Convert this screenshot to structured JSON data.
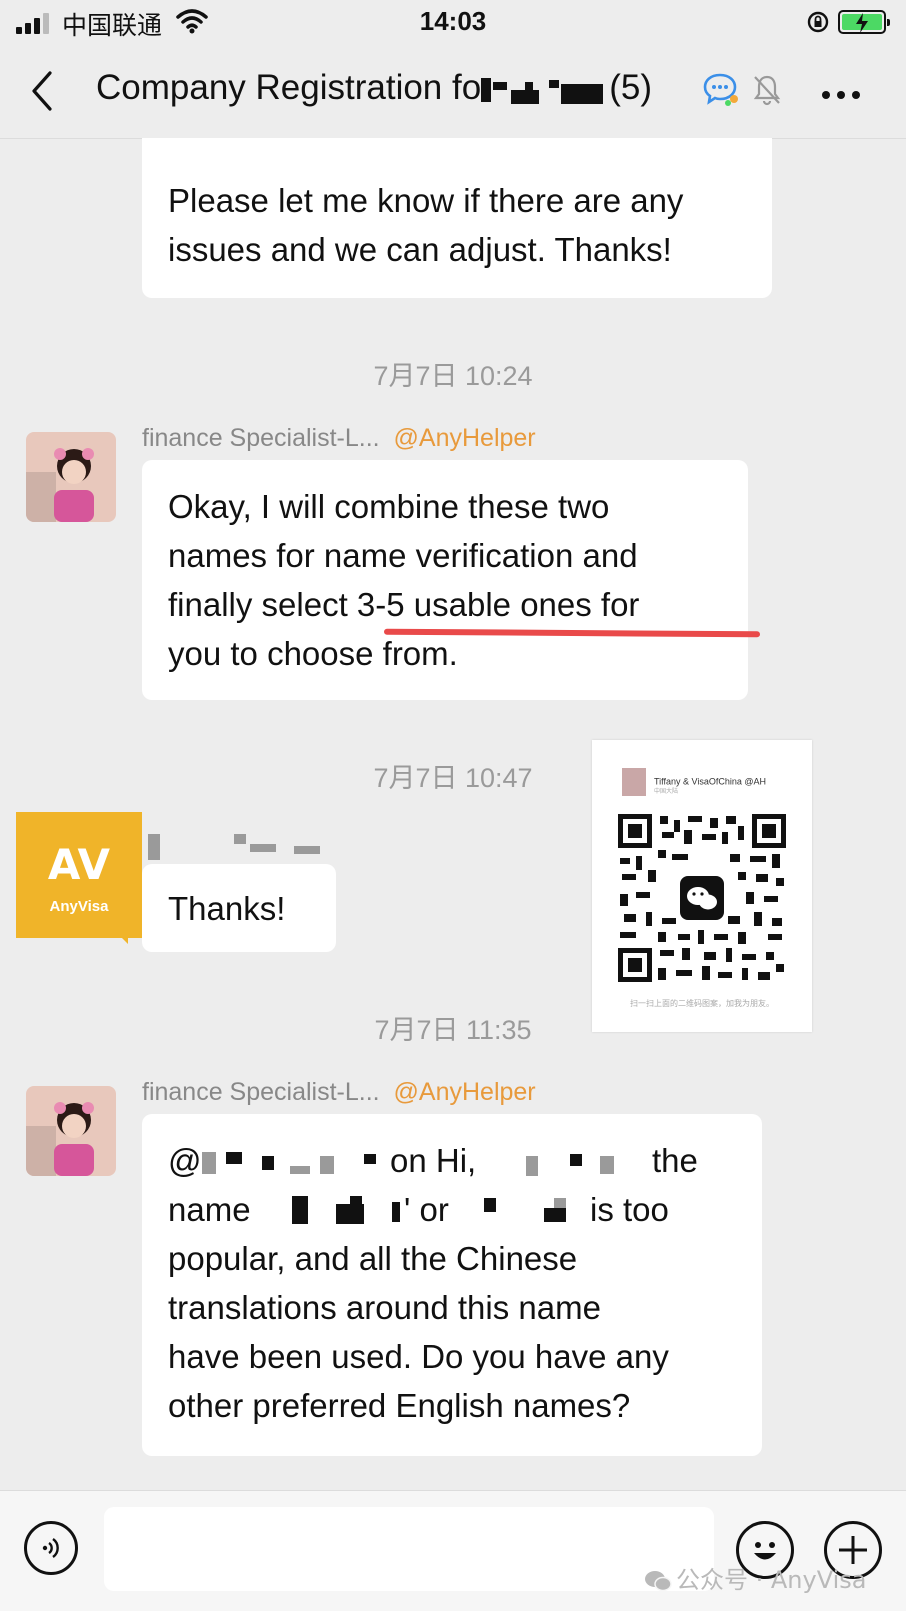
{
  "status_bar": {
    "carrier": "中国联通",
    "time": "14:03"
  },
  "header": {
    "title_prefix": "Company Registration fo",
    "title_suffix": "(5)",
    "icons": [
      "back-chevron-icon",
      "chat-bubble-icon",
      "bell-muted-icon",
      "more-icon"
    ]
  },
  "messages": {
    "m1": {
      "text_lines": [
        "Please let me know if there are any",
        "issues and we can adjust. Thanks!"
      ]
    },
    "time1": "7月7日 10:24",
    "m2": {
      "sender_name": "finance  Specialist-L...",
      "sender_tag": "@AnyHelper",
      "text_lines": [
        "Okay, I will combine these two",
        "names for name verification and",
        "finally select 3-5 usable ones for",
        "you to choose from."
      ]
    },
    "time2": "7月7日 10:47",
    "m3": {
      "avatar_text": "AV",
      "avatar_brand": "AnyVisa",
      "text": "Thanks!"
    },
    "qr_card": {
      "name": "Tiffany & VisaOfChina @AH",
      "sub": "中国大陆",
      "foot": "扫一扫上面的二维码图案，加我为朋友。"
    },
    "time3": "7月7日 11:35",
    "m4": {
      "sender_name": "finance  Specialist-L...",
      "sender_tag": "@AnyHelper",
      "line1_a": "@",
      "line1_b": "on Hi,",
      "line1_c": "the",
      "line2_a": "name",
      "line2_b": "' or",
      "line2_c": "is too",
      "text_lines": [
        "popular, and all the Chinese",
        "translations around this name",
        "have been used. Do you have any",
        "other preferred English names?"
      ]
    }
  },
  "input_bar": {
    "icons": [
      "voice-icon",
      "emoji-icon",
      "plus-icon"
    ]
  },
  "watermark": "公众号 · AnyVisa",
  "colors": {
    "background": "#ededed",
    "bubble": "#ffffff",
    "tag": "#e89a3c",
    "underline": "#e94a4a",
    "anyvisa": "#f0b429"
  }
}
